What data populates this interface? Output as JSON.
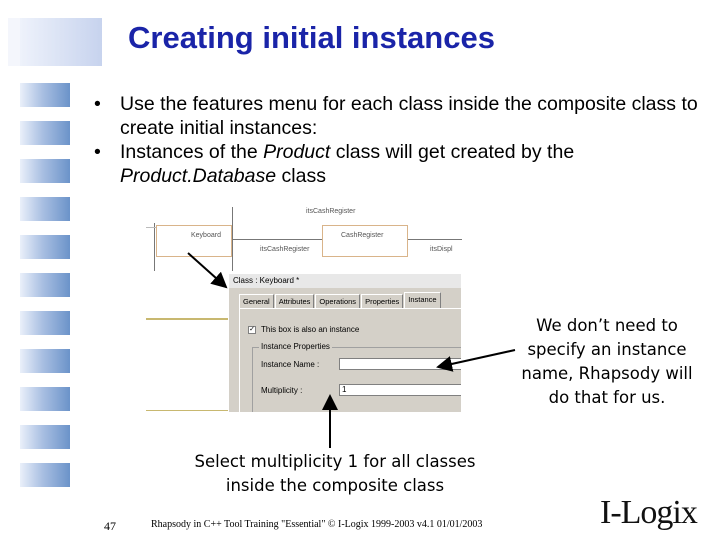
{
  "slide": {
    "title": "Creating initial instances",
    "bullets": [
      {
        "marker": "•",
        "parts": [
          "Use the features menu for each class inside the composite class to create initial instances:"
        ]
      },
      {
        "marker": "•",
        "parts": [
          "Instances of the ",
          "Product",
          " class will get created by the ",
          "Product.Database",
          " class"
        ]
      }
    ],
    "callout_right": "We don’t need to specify an instance name, Rhapsody will do that for us.",
    "callout_bottom": "Select multiplicity 1 for all classes inside the composite class",
    "footer_page": "47",
    "footer_text": "Rhapsody in C++ Tool Training \"Essential\" © I-Logix 1999-2003 v4.1 01/01/2003",
    "logo": "I-Logix"
  },
  "diagram": {
    "label_top": "itsCashRegister",
    "box_left": "Keyboard",
    "box_right": "CashRegister",
    "label_mid": "itsCashRegister",
    "label_right": "itsDispl"
  },
  "dialog": {
    "title": "Class : Keyboard *",
    "tabs": [
      "General",
      "Attributes",
      "Operations",
      "Properties",
      "Instance"
    ],
    "checkbox_label": "This box is also an instance",
    "checkbox_checked": "✓",
    "group_label": "Instance Properties",
    "name_label": "Instance Name :",
    "name_value": "",
    "multiplicity_label": "Multiplicity :",
    "multiplicity_value": "1"
  },
  "colors": {
    "title": "#1a24a8",
    "accent_bar": "#6b93c9",
    "dialog_bg": "#d4d0c8"
  }
}
